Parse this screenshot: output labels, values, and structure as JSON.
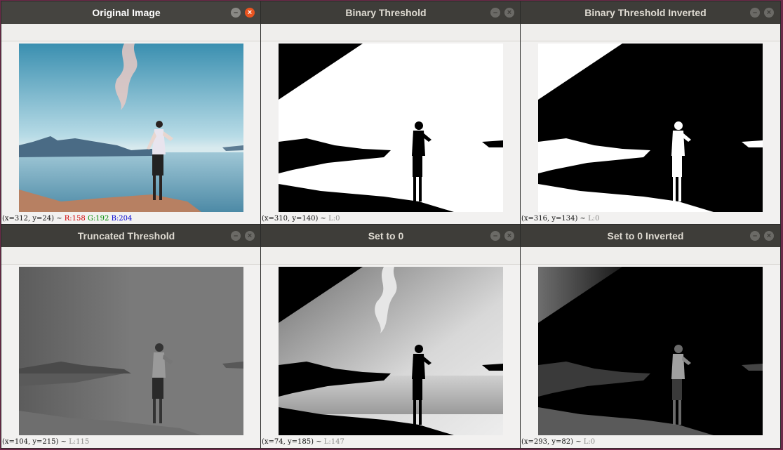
{
  "colors": {
    "titlebar": "#3e3d39",
    "close_active": "#e95420",
    "desktop": "#6e2a4a"
  },
  "windows": [
    {
      "title": "Original Image",
      "status": {
        "coords": "(x=312, y=24) ~ ",
        "r": "R:158",
        "g": "G:192",
        "b": "B:204"
      }
    },
    {
      "title": "Binary Threshold",
      "status": {
        "coords": "(x=310, y=140) ~ ",
        "value": "L:0"
      }
    },
    {
      "title": "Binary Threshold Inverted",
      "status": {
        "coords": "(x=316, y=134) ~ ",
        "value": "L:0"
      }
    },
    {
      "title": "Truncated Threshold",
      "status": {
        "coords": "(x=104, y=215) ~ ",
        "value": "L:115"
      }
    },
    {
      "title": "Set to 0",
      "status": {
        "coords": "(x=74, y=185) ~ ",
        "value": "L:147"
      }
    },
    {
      "title": "Set to 0 Inverted",
      "status": {
        "coords": "(x=293, y=82) ~ ",
        "value": "L:0"
      }
    }
  ],
  "icons": {
    "minimize": "minimize-icon",
    "close": "close-icon"
  }
}
